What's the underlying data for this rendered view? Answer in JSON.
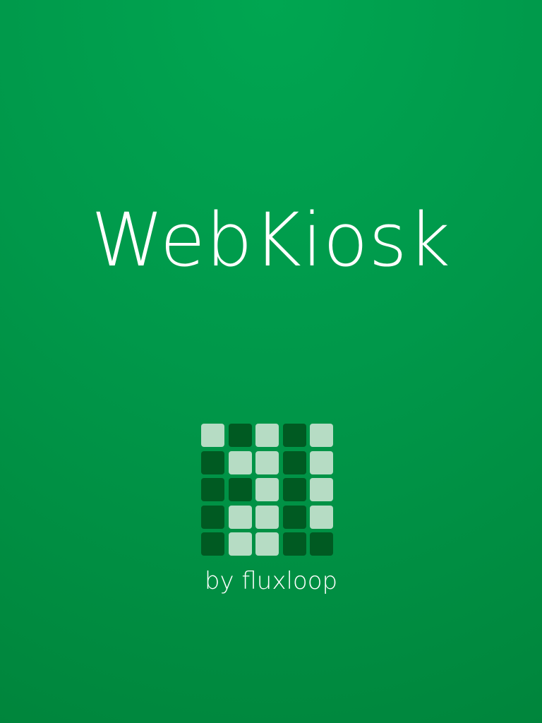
{
  "splash": {
    "app_title": "WebKiosk",
    "byline": "by fluxloop",
    "logo_icon": "fluxloop-grid-logo-icon"
  },
  "colors": {
    "background_top": "#00a651",
    "background_bottom": "#007f38",
    "text": "#ffffff",
    "logo_light": "#b6dcc4",
    "logo_dark": "#005a22"
  },
  "logo": {
    "grid": [
      [
        "light",
        "dark",
        "light",
        "dark",
        "light"
      ],
      [
        "dark",
        "light",
        "light",
        "dark",
        "light"
      ],
      [
        "dark",
        "dark",
        "light",
        "dark",
        "light"
      ],
      [
        "dark",
        "light",
        "light",
        "dark",
        "light"
      ],
      [
        "dark",
        "light",
        "light",
        "dark",
        "dark"
      ]
    ]
  }
}
